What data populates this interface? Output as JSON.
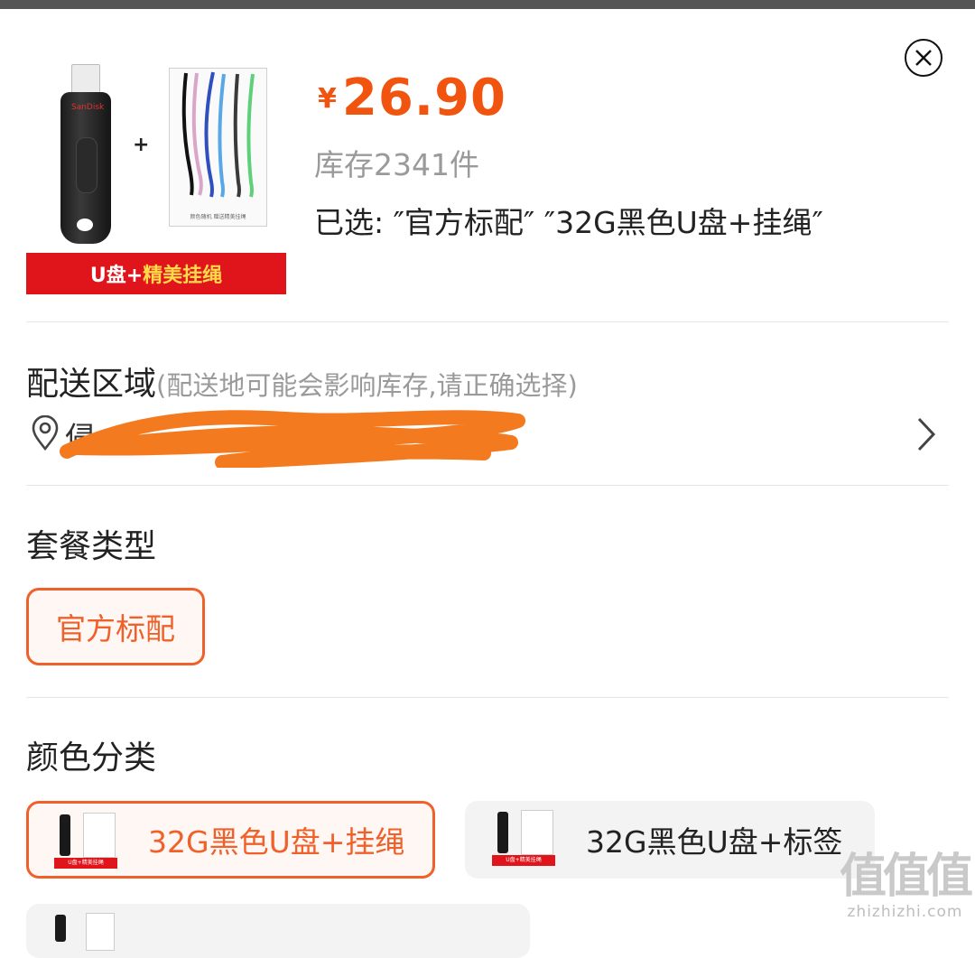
{
  "product": {
    "image_banner_prefix": "U盘+",
    "image_banner_highlight": "精美挂绳",
    "plus_sign": "+",
    "usb_brand": "SanDisk",
    "lanyard_caption": "颜色随机 赠送精美挂绳"
  },
  "price": {
    "currency": "¥",
    "value": "26.90"
  },
  "stock_text": "库存2341件",
  "selected_text": "已选: ″官方标配″ ″32G黑色U盘+挂绳″",
  "delivery": {
    "title": "配送区域",
    "note": "(配送地可能会影响库存,请正确选择)",
    "address_visible": "侵"
  },
  "package": {
    "title": "套餐类型",
    "options": [
      {
        "label": "官方标配",
        "selected": true
      }
    ]
  },
  "color": {
    "title": "颜色分类",
    "options": [
      {
        "label": "32G黑色U盘+挂绳",
        "selected": true
      },
      {
        "label": "32G黑色U盘+标签",
        "selected": false
      }
    ]
  },
  "thumbs": {
    "banner_1": "U盘+精美挂绳",
    "banner_2": "U盘+精美挂绳"
  },
  "watermark": {
    "chars": "值值值",
    "url": "zhizhizhi.com"
  },
  "colors": {
    "accent": "#f0540f",
    "banner_red": "#e0151b",
    "muted": "#9a9a9a"
  },
  "icons": [
    "close-icon",
    "location-pin-icon",
    "chevron-right-icon"
  ]
}
